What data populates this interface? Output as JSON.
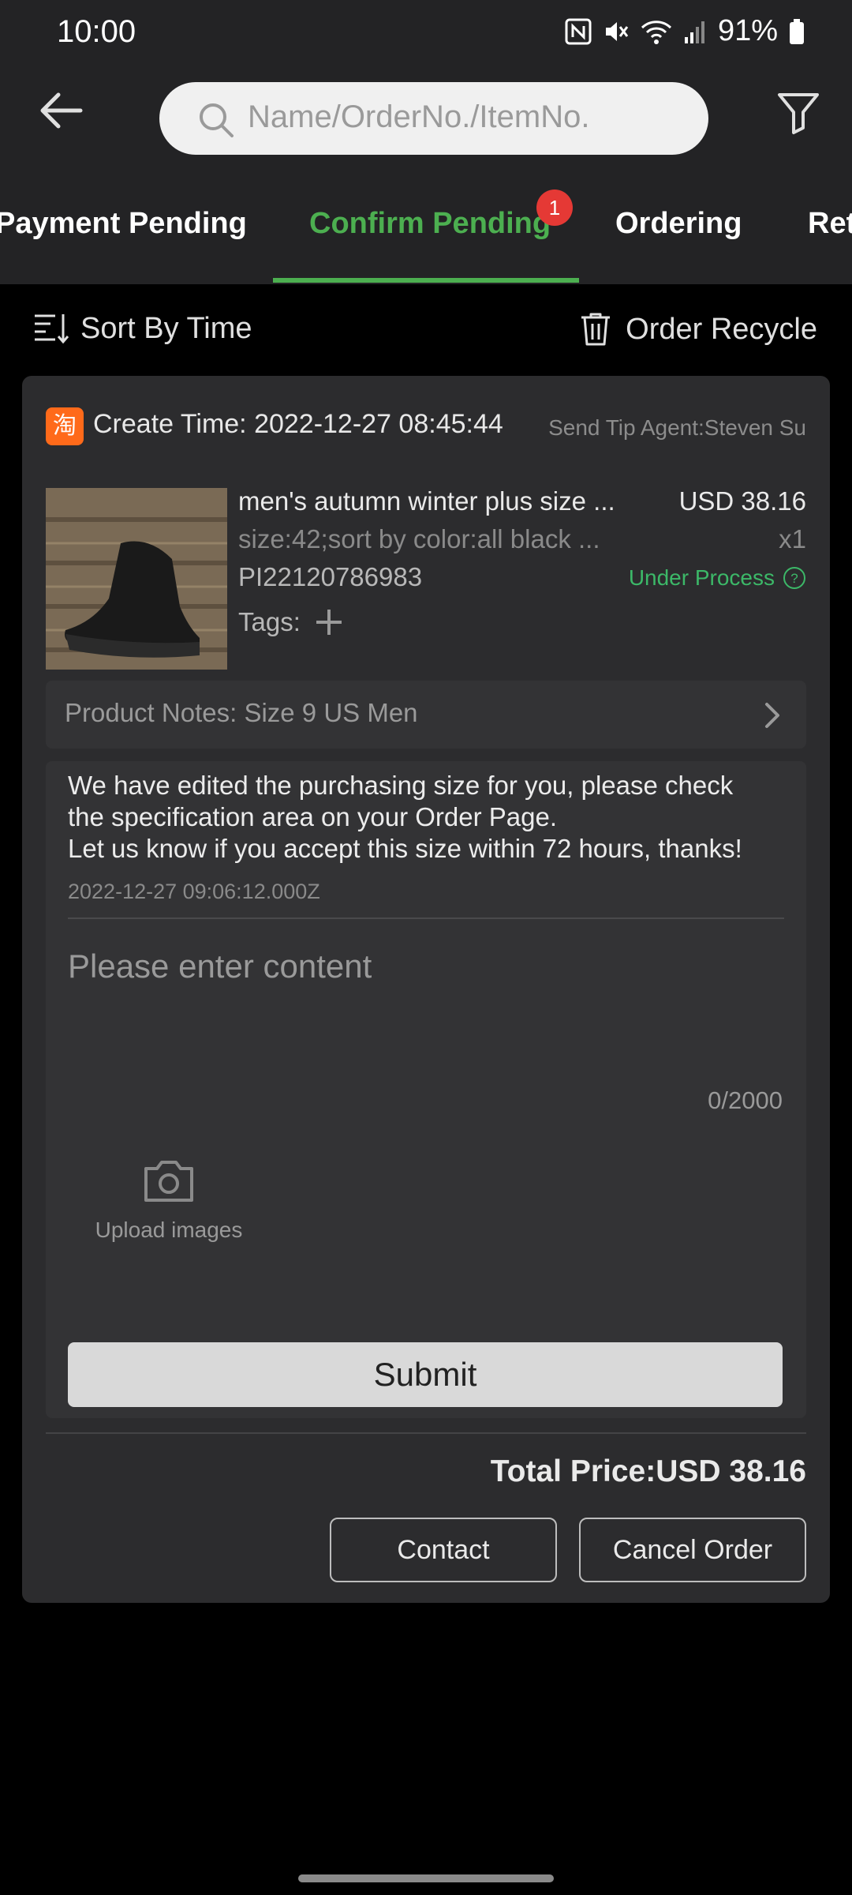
{
  "status_bar": {
    "time": "10:00",
    "battery": "91%"
  },
  "header": {
    "search_placeholder": "Name/OrderNo./ItemNo."
  },
  "tabs": [
    {
      "label": "Payment Pending"
    },
    {
      "label": "Confirm Pending",
      "active": true,
      "badge": "1"
    },
    {
      "label": "Ordering"
    },
    {
      "label": "Ret"
    }
  ],
  "toolbar": {
    "sort_label": "Sort By Time",
    "recycle_label": "Order Recycle"
  },
  "order": {
    "shop_glyph": "淘",
    "create_time": "Create Time: 2022-12-27 08:45:44",
    "agent": "Send Tip Agent:Steven Su",
    "item": {
      "title": "men's autumn winter plus size ...",
      "price": "USD 38.16",
      "spec": "size:42;sort by color:all black ...",
      "quantity": "x1",
      "item_no": "PI22120786983",
      "status": "Under Process",
      "tags_label": "Tags:"
    },
    "notes": "Product Notes: Size 9 US Men",
    "message": {
      "line1": "We have edited the purchasing size for you, please check",
      "line2": "the specification area on your Order Page.",
      "line3": "Let us know if you accept this size within 72 hours, thanks!",
      "date": "2022-12-27 09:06:12.000Z"
    },
    "reply": {
      "placeholder": "Please enter content",
      "counter": "0/2000",
      "upload_label": "Upload images",
      "submit_label": "Submit"
    },
    "total": "Total Price:USD 38.16",
    "contact_label": "Contact",
    "cancel_label": "Cancel Order"
  },
  "colors": {
    "accent": "#4caf50",
    "badge": "#e53935",
    "status_ok": "#3cb868",
    "background": "#000000",
    "card": "#2c2c2e"
  }
}
